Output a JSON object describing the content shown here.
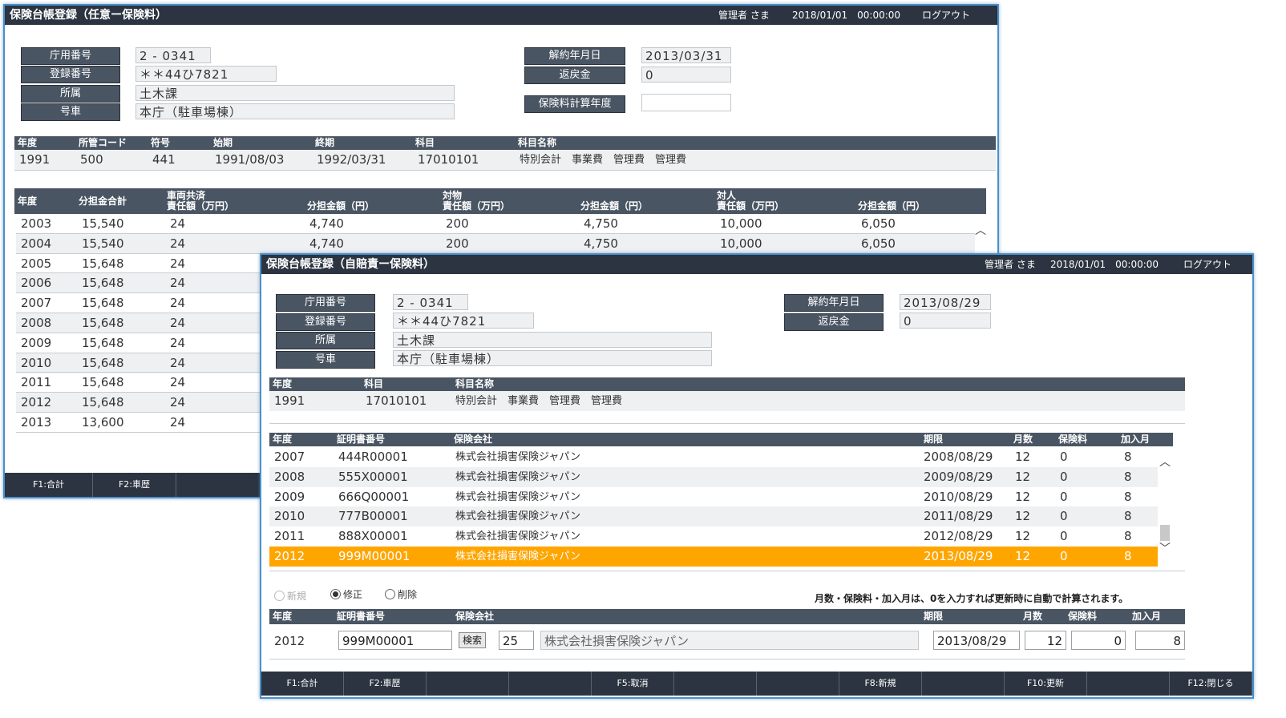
{
  "win1": {
    "title": "保険台帳登録（任意ー保険料）",
    "user": "管理者 さま",
    "datetime": "2018/01/01　00:00:00",
    "logout": "ログアウト",
    "labels": {
      "office_no": "庁用番号",
      "reg_no": "登録番号",
      "dept": "所属",
      "car": "号車",
      "cancel_date": "解約年月日",
      "refund": "返戻金",
      "calc_year": "保険料計算年度"
    },
    "values": {
      "office_no": "2 - 0341",
      "reg_no": "＊＊44ひ7821",
      "dept": "土木課",
      "car": "本庁（駐車場棟）",
      "cancel_date": "2013/03/31",
      "refund": "0",
      "calc_year": ""
    },
    "table1": {
      "headers": [
        "年度",
        "所管コード",
        "符号",
        "始期",
        "終期",
        "科目",
        "科目名称"
      ],
      "row": [
        "1991",
        "500",
        "441",
        "1991/08/03",
        "1992/03/31",
        "17010101",
        "特別会計　事業費　管理費　管理費"
      ]
    },
    "table2": {
      "headers": [
        "年度",
        "分担金合計",
        "車両共済\n責任額（万円）",
        "分担金額（円）",
        "対物\n責任額（万円）",
        "分担金額（円）",
        "対人\n責任額（万円）",
        "分担金額（円）"
      ],
      "rows": [
        [
          "2003",
          "15,540",
          "24",
          "4,740",
          "200",
          "4,750",
          "10,000",
          "6,050"
        ],
        [
          "2004",
          "15,540",
          "24",
          "4,740",
          "200",
          "4,750",
          "10,000",
          "6,050"
        ],
        [
          "2005",
          "15,648",
          "24"
        ],
        [
          "2006",
          "15,648",
          "24"
        ],
        [
          "2007",
          "15,648",
          "24"
        ],
        [
          "2008",
          "15,648",
          "24"
        ],
        [
          "2009",
          "15,648",
          "24"
        ],
        [
          "2010",
          "15,648",
          "24"
        ],
        [
          "2011",
          "15,648",
          "24"
        ],
        [
          "2012",
          "15,648",
          "24"
        ],
        [
          "2013",
          "13,600",
          "24"
        ]
      ]
    },
    "fkeys": [
      "F1:合計",
      "F2:車歴"
    ]
  },
  "win2": {
    "title": "保険台帳登録（自賠責ー保険料）",
    "user": "管理者 さま",
    "datetime": "2018/01/01　00:00:00",
    "logout": "ログアウト",
    "labels": {
      "office_no": "庁用番号",
      "reg_no": "登録番号",
      "dept": "所属",
      "car": "号車",
      "cancel_date": "解約年月日",
      "refund": "返戻金"
    },
    "values": {
      "office_no": "2 - 0341",
      "reg_no": "＊＊44ひ7821",
      "dept": "土木課",
      "car": "本庁（駐車場棟）",
      "cancel_date": "2013/08/29",
      "refund": "0"
    },
    "table1": {
      "headers": [
        "年度",
        "科目",
        "科目名称"
      ],
      "row": [
        "1991",
        "17010101",
        "特別会計　事業費　管理費　管理費"
      ]
    },
    "table2": {
      "headers": [
        "年度",
        "証明書番号",
        "保険会社",
        "期限",
        "月数",
        "保険料",
        "加入月"
      ],
      "rows": [
        [
          "2007",
          "444R00001",
          "株式会社損害保険ジャパン",
          "2008/08/29",
          "12",
          "0",
          "8"
        ],
        [
          "2008",
          "555X00001",
          "株式会社損害保険ジャパン",
          "2009/08/29",
          "12",
          "0",
          "8"
        ],
        [
          "2009",
          "666Q00001",
          "株式会社損害保険ジャパン",
          "2010/08/29",
          "12",
          "0",
          "8"
        ],
        [
          "2010",
          "777B00001",
          "株式会社損害保険ジャパン",
          "2011/08/29",
          "12",
          "0",
          "8"
        ],
        [
          "2011",
          "888X00001",
          "株式会社損害保険ジャパン",
          "2012/08/29",
          "12",
          "0",
          "8"
        ],
        [
          "2012",
          "999M00001",
          "株式会社損害保険ジャパン",
          "2013/08/29",
          "12",
          "0",
          "8"
        ]
      ]
    },
    "radios": {
      "new": "新規",
      "edit": "修正",
      "delete": "削除"
    },
    "note": "月数・保険料・加入月は、0を入力すれば更新時に自動で計算されます。",
    "form": {
      "headers": [
        "年度",
        "証明書番号",
        "保険会社",
        "期限",
        "月数",
        "保険料",
        "加入月"
      ],
      "year": "2012",
      "cert_no": "999M00001",
      "search_label": "検索",
      "company_code": "25",
      "company_name": "株式会社損害保険ジャパン",
      "expiry": "2013/08/29",
      "months": "12",
      "premium": "0",
      "join_month": "8"
    },
    "fkeys": [
      "F1:合計",
      "F2:車歴",
      "",
      "",
      "F5:取消",
      "",
      "",
      "F8:新規",
      "",
      "F10:更新",
      "",
      "F12:閉じる"
    ]
  },
  "colors": {
    "header_bg": "#2b3440",
    "label_bg": "#4a5563",
    "selected_row": "#ffa500",
    "window_border": "#4a90c8"
  }
}
